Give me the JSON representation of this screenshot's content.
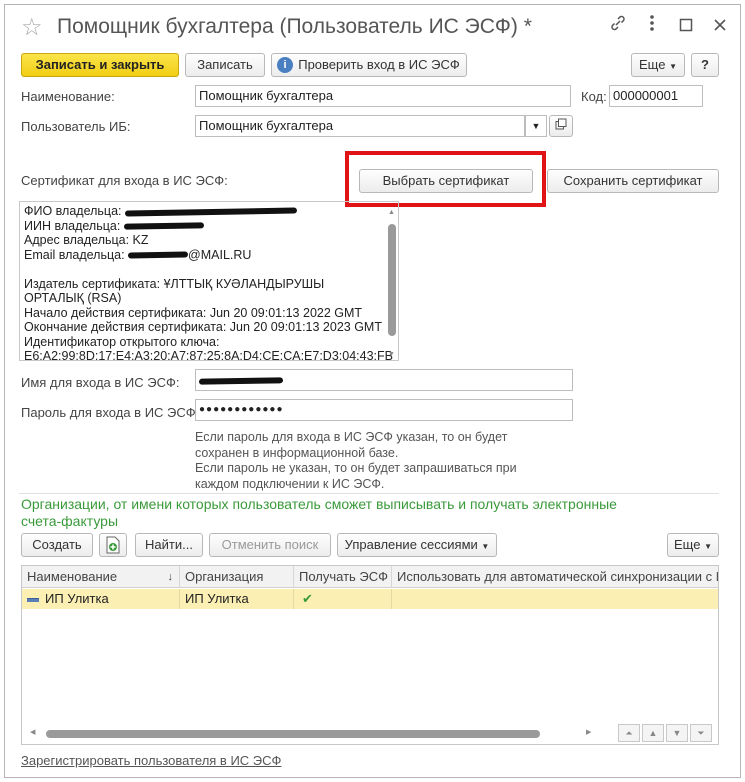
{
  "window": {
    "title": "Помощник бухгалтера (Пользователь ИС ЭСФ) *",
    "icons": [
      "star-icon",
      "link-icon",
      "more-icon",
      "maximize-icon",
      "close-icon"
    ]
  },
  "toolbar": {
    "save_close": "Записать и закрыть",
    "save": "Записать",
    "check_login": "Проверить вход в ИС ЭСФ",
    "more": "Еще",
    "help": "?"
  },
  "form": {
    "name_label": "Наименование:",
    "name_value": "Помощник бухгалтера",
    "code_label": "Код:",
    "code_value": "000000001",
    "ib_user_label": "Пользователь ИБ:",
    "ib_user_value": "Помощник бухгалтера",
    "cert_label": "Сертификат для входа в ИС ЭСФ:",
    "select_cert": "Выбрать сертификат",
    "save_cert": "Сохранить сертификат"
  },
  "certificate": {
    "owner_fio": "ФИО владельца:",
    "owner_iin": "ИИН владельца:",
    "owner_address": "Адрес владельца: KZ",
    "owner_email_label": "Email владельца:",
    "owner_email_suffix": "@MAIL.RU",
    "issuer_line1": "Издатель сертификата: ҰЛТТЫҚ КУӘЛАНДЫРУШЫ",
    "issuer_line2": "ОРТАЛЫҚ (RSA)",
    "valid_from": "Начало действия сертификата: Jun 20 09:01:13 2022 GMT",
    "valid_to": "Окончание действия сертификата: Jun 20 09:01:13 2023 GMT",
    "key_id_label": "Идентификатор открытого ключа:",
    "key_id_value": "E6:A2:99:8D:17:E4:A3:20:A7:87:25:8A:D4:CE:CA:E7:D3:04:43:FB"
  },
  "login": {
    "username_label": "Имя для входа в ИС ЭСФ:",
    "password_label": "Пароль для входа в ИС ЭСФ:",
    "password_value": "●●●●●●●●●●●●",
    "note1": "Если пароль для входа в ИС ЭСФ указан, то он будет сохранен в информационной базе.",
    "note2": "Если пароль не указан, то он будет запрашиваться при каждом подключении к ИС ЭСФ."
  },
  "orgs": {
    "heading": "Организации, от имени которых пользователь сможет выписывать и получать электронные счета-фактуры",
    "create": "Создать",
    "find": "Найти...",
    "cancel_search": "Отменить поиск",
    "session_mgmt": "Управление сессиями",
    "more": "Еще",
    "columns": [
      "Наименование",
      "Организация",
      "Получать ЭСФ",
      "Использовать для автоматической синхронизации с ИС ЭСФ"
    ],
    "rows": [
      {
        "name": "ИП Улитка",
        "organization": "ИП Улитка",
        "receive": "✔"
      }
    ]
  },
  "footer": {
    "register_link": "Зарегистрировать пользователя в ИС ЭСФ"
  },
  "colors": {
    "accent_yellow": "#f5d624",
    "highlight_red": "#e01414",
    "heading_green": "#3a9a3a",
    "selected_row": "#fbefb4"
  }
}
